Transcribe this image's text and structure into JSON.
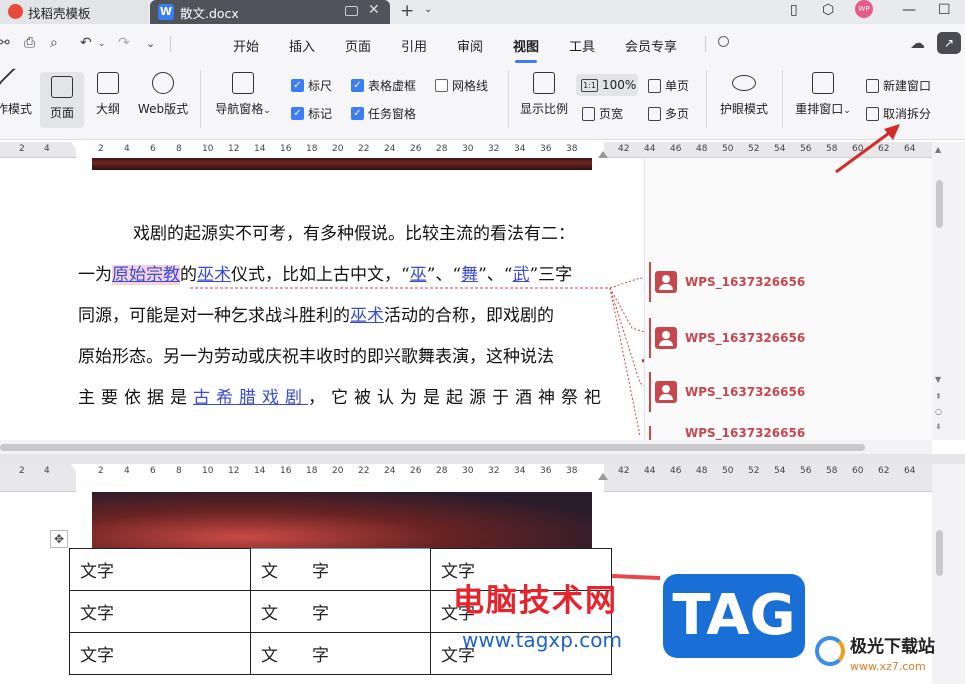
{
  "tabs": [
    {
      "label": "找稻壳模板"
    },
    {
      "label": "散文.docx",
      "icon_letter": "W"
    }
  ],
  "avatar_text": "WP",
  "menus": [
    "开始",
    "插入",
    "页面",
    "引用",
    "审阅",
    "视图",
    "工具",
    "会员专享"
  ],
  "active_menu": "视图",
  "ribbon": {
    "write_mode": "作模式",
    "page": "页面",
    "outline": "大纲",
    "web": "Web版式",
    "nav_pane": "导航窗格",
    "ruler": "标尺",
    "table_gridlines": "表格虚框",
    "gridlines": "网格线",
    "marks": "标记",
    "task_pane": "任务窗格",
    "zoom": "显示比例",
    "zoom_100": "100%",
    "zoom_100_icon": "1:1",
    "page_width": "页宽",
    "single_page": "单页",
    "multi_page": "多页",
    "eye_mode": "护眼模式",
    "rearrange": "重排窗口",
    "new_window": "新建窗口",
    "cancel_split": "取消拆分"
  },
  "ruler_numbers_top": [
    "4",
    "2",
    "2",
    "4",
    "6",
    "8",
    "10",
    "12",
    "14",
    "16",
    "18",
    "20",
    "22",
    "24",
    "26",
    "28",
    "30",
    "32",
    "34",
    "36",
    "38",
    "42",
    "44",
    "46",
    "48",
    "50",
    "52",
    "54",
    "56",
    "58",
    "60",
    "62",
    "64"
  ],
  "ruler_numbers_bottom": [
    "4",
    "2",
    "2",
    "4",
    "6",
    "8",
    "10",
    "12",
    "14",
    "16",
    "18",
    "20",
    "22",
    "24",
    "26",
    "28",
    "30",
    "32",
    "34",
    "36",
    "38",
    "42",
    "44",
    "46",
    "48",
    "50",
    "52",
    "54",
    "56",
    "58",
    "60",
    "62",
    "64"
  ],
  "paragraph": {
    "line1": "戏剧的起源实不可考，有多种假说。比较主流的看法有二：",
    "line2": [
      "一为",
      "原始宗教",
      "的",
      "巫术",
      "仪式，比如上古中文，“",
      "巫",
      "”、“",
      "舞",
      "”、“",
      "武",
      "”三字"
    ],
    "line3": [
      "同源，可能是对一种乞求战斗胜利的",
      "巫术",
      "活动的合称，即戏剧的"
    ],
    "line4": "原始形态。另一为劳动或庆祝丰收时的即兴歌舞表演，这种说法",
    "line5": [
      "主要依据是",
      "古希腊戏剧",
      "，它被认为是起源于酒神祭祀"
    ]
  },
  "comments": [
    "WPS_1637326656",
    "WPS_1637326656",
    "WPS_1637326656",
    "WPS_1637326656"
  ],
  "table": [
    [
      "文字",
      "文　　字",
      "文字"
    ],
    [
      "文字",
      "文　　字",
      "文字"
    ],
    [
      "文字",
      "文　　字",
      "文字"
    ]
  ],
  "watermark": {
    "cn": "电脑技术网",
    "url": "www.tagxp.com",
    "tag": "TAG",
    "site": "极光下载站",
    "site_url": "www.xz7.com"
  },
  "colors": {
    "accent": "#3b7df5",
    "comment": "#c8474e",
    "arrow": "#d42a2a",
    "link": "#3b4bd4"
  }
}
